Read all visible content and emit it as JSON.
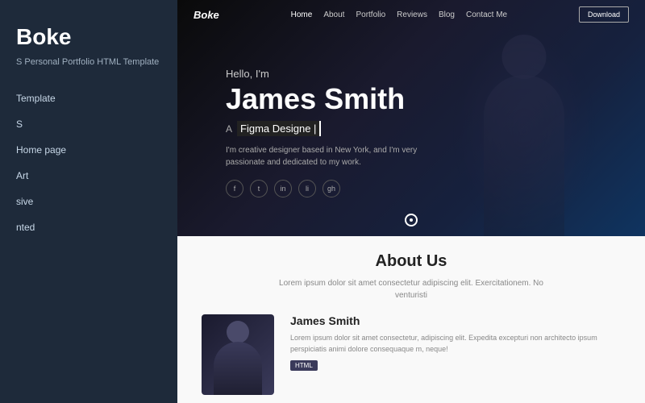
{
  "sidebar": {
    "logo": "Boke",
    "subtitle": "S Personal Portfolio HTML Template",
    "items": [
      {
        "id": "template",
        "label": "Template"
      },
      {
        "id": "s",
        "label": "S"
      },
      {
        "id": "home-page",
        "label": "Home page"
      },
      {
        "id": "art",
        "label": "Art"
      },
      {
        "id": "sive",
        "label": "sive"
      },
      {
        "id": "nted",
        "label": "nted"
      }
    ]
  },
  "nav": {
    "logo": "Boke",
    "links": [
      {
        "id": "home",
        "label": "Home",
        "active": true
      },
      {
        "id": "about",
        "label": "About",
        "active": false
      },
      {
        "id": "portfolio",
        "label": "Portfolio",
        "active": false
      },
      {
        "id": "reviews",
        "label": "Reviews",
        "active": false
      },
      {
        "id": "blog",
        "label": "Blog",
        "active": false
      },
      {
        "id": "contact",
        "label": "Contact Me",
        "active": false
      }
    ],
    "download_btn": "Download"
  },
  "hero": {
    "greeting": "Hello, I'm",
    "name": "James Smith",
    "role_prefix": "A",
    "role": "Figma Designe |",
    "description": "I'm creative designer based in New York, and I'm very passionate and dedicated to my work.",
    "social": [
      {
        "id": "facebook",
        "icon": "f"
      },
      {
        "id": "twitter",
        "icon": "t"
      },
      {
        "id": "instagram",
        "icon": "in"
      },
      {
        "id": "linkedin",
        "icon": "li"
      },
      {
        "id": "github",
        "icon": "gh"
      }
    ]
  },
  "about": {
    "title": "About Us",
    "description": "Lorem ipsum dolor sit amet consectetur adipiscing elit. Exercitationem. No venturisti",
    "person_name": "James Smith",
    "person_description": "Lorem ipsum dolor sit amet consectetur, adipiscing elit. Expedita excepturi non architecto ipsum perspiciatis animi dolore consequaque m, neque!",
    "html_badge": "HTML"
  }
}
